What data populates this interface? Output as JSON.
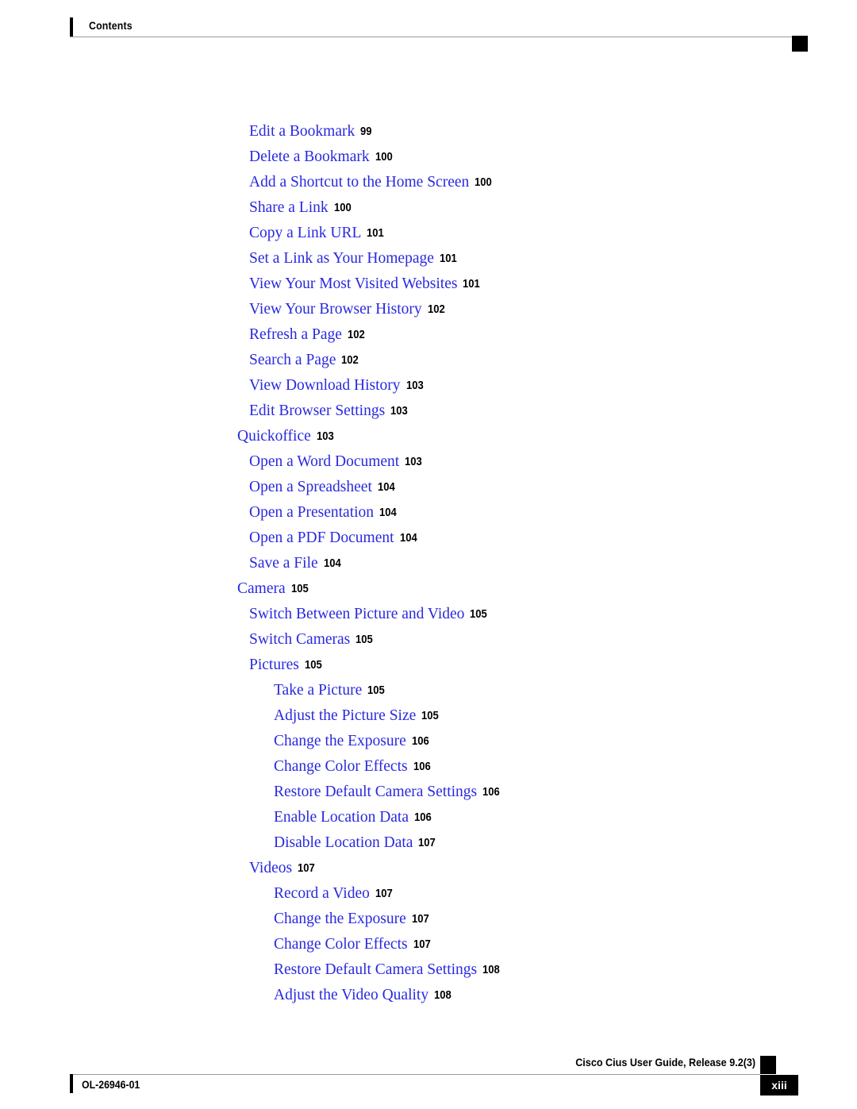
{
  "header": {
    "running_head": "Contents"
  },
  "toc": {
    "entries": [
      {
        "title": "Edit a Bookmark",
        "page": "99",
        "level": 2
      },
      {
        "title": "Delete a Bookmark",
        "page": "100",
        "level": 2
      },
      {
        "title": "Add a Shortcut to the Home Screen",
        "page": "100",
        "level": 2
      },
      {
        "title": "Share a Link",
        "page": "100",
        "level": 2
      },
      {
        "title": "Copy a Link URL",
        "page": "101",
        "level": 2
      },
      {
        "title": "Set a Link as Your Homepage",
        "page": "101",
        "level": 2
      },
      {
        "title": "View Your Most Visited Websites",
        "page": "101",
        "level": 2
      },
      {
        "title": "View Your Browser History",
        "page": "102",
        "level": 2
      },
      {
        "title": "Refresh a Page",
        "page": "102",
        "level": 2
      },
      {
        "title": "Search a Page",
        "page": "102",
        "level": 2
      },
      {
        "title": "View Download History",
        "page": "103",
        "level": 2
      },
      {
        "title": "Edit Browser Settings",
        "page": "103",
        "level": 2
      },
      {
        "title": "Quickoffice",
        "page": "103",
        "level": 1
      },
      {
        "title": "Open a Word Document",
        "page": "103",
        "level": 2
      },
      {
        "title": "Open a Spreadsheet",
        "page": "104",
        "level": 2
      },
      {
        "title": "Open a Presentation",
        "page": "104",
        "level": 2
      },
      {
        "title": "Open a PDF Document",
        "page": "104",
        "level": 2
      },
      {
        "title": "Save a File",
        "page": "104",
        "level": 2
      },
      {
        "title": "Camera",
        "page": "105",
        "level": 1
      },
      {
        "title": "Switch Between Picture and Video",
        "page": "105",
        "level": 2
      },
      {
        "title": "Switch Cameras",
        "page": "105",
        "level": 2
      },
      {
        "title": "Pictures",
        "page": "105",
        "level": 2
      },
      {
        "title": "Take a Picture",
        "page": "105",
        "level": 3
      },
      {
        "title": "Adjust the Picture Size",
        "page": "105",
        "level": 3
      },
      {
        "title": "Change the Exposure",
        "page": "106",
        "level": 3
      },
      {
        "title": "Change Color Effects",
        "page": "106",
        "level": 3
      },
      {
        "title": "Restore Default Camera Settings",
        "page": "106",
        "level": 3
      },
      {
        "title": "Enable Location Data",
        "page": "106",
        "level": 3
      },
      {
        "title": "Disable Location Data",
        "page": "107",
        "level": 3
      },
      {
        "title": "Videos",
        "page": "107",
        "level": 2
      },
      {
        "title": "Record a Video",
        "page": "107",
        "level": 3
      },
      {
        "title": "Change the Exposure",
        "page": "107",
        "level": 3
      },
      {
        "title": "Change Color Effects",
        "page": "107",
        "level": 3
      },
      {
        "title": "Restore Default Camera Settings",
        "page": "108",
        "level": 3
      },
      {
        "title": "Adjust the Video Quality",
        "page": "108",
        "level": 3
      }
    ]
  },
  "footer": {
    "document_id": "OL-26946-01",
    "guide_title": "Cisco Cius User Guide, Release 9.2(3)",
    "page_number": "xiii"
  },
  "colors": {
    "link": "#2929e0",
    "text": "#000000",
    "rule": "#9a9a9a"
  }
}
